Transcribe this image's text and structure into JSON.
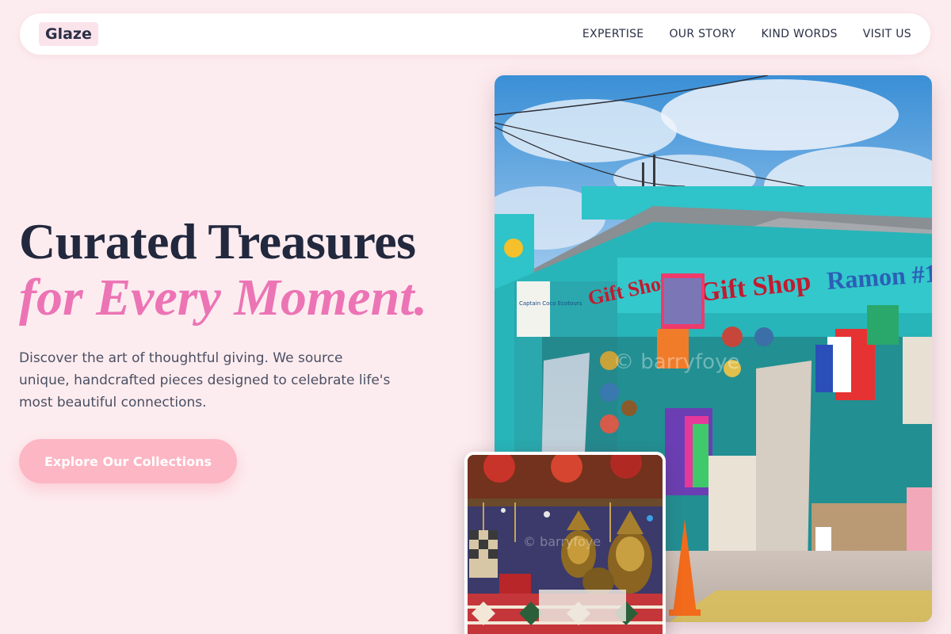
{
  "header": {
    "logo": "Glaze",
    "nav": [
      {
        "label": "EXPERTISE"
      },
      {
        "label": "OUR STORY"
      },
      {
        "label": "KIND WORDS"
      },
      {
        "label": "VISIT US"
      }
    ]
  },
  "hero": {
    "title_line1": "Curated Treasures",
    "title_line2": "for Every Moment.",
    "description": "Discover the art of thoughtful giving. We source unique, handcrafted pieces designed to celebrate life's most beautiful connections.",
    "cta_label": "Explore Our Collections"
  },
  "photos": {
    "main": {
      "sign_left": "Gift Shop",
      "sign_center": "Gift Shop",
      "sign_right": "Ramon #1",
      "small_sign": "Captain Coco Ecotours",
      "watermark": "© barryfoye"
    },
    "small": {
      "watermark": "© barryfoye"
    }
  },
  "colors": {
    "background": "#fdecef",
    "accent_pink": "#ec74b5",
    "button_pink": "#fdb6c4",
    "text_dark": "#22283d",
    "shop_teal": "#2ec4c9"
  }
}
